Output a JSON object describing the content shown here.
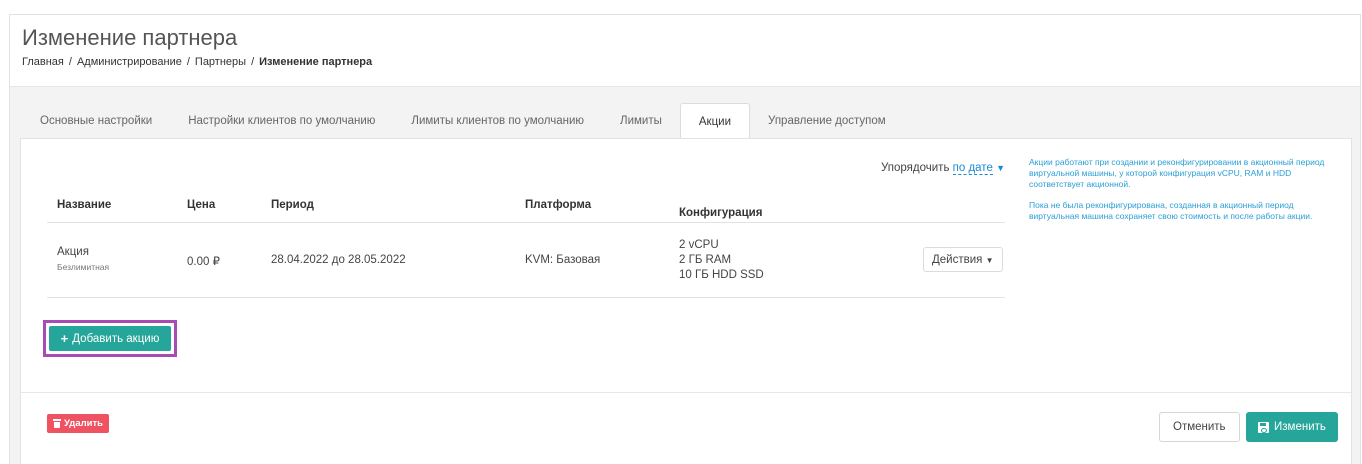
{
  "header": {
    "title": "Изменение партнера",
    "breadcrumbs": [
      "Главная",
      "Администрирование",
      "Партнеры",
      "Изменение партнера"
    ],
    "separator": "/"
  },
  "tabs": [
    {
      "label": "Основные настройки",
      "active": false
    },
    {
      "label": "Настройки клиентов по умолчанию",
      "active": false
    },
    {
      "label": "Лимиты клиентов по умолчанию",
      "active": false
    },
    {
      "label": "Лимиты",
      "active": false
    },
    {
      "label": "Акции",
      "active": true
    },
    {
      "label": "Управление доступом",
      "active": false
    }
  ],
  "sort": {
    "label": "Упорядочить",
    "value": "по дате",
    "icon": "caret-down-icon"
  },
  "info": {
    "paragraph1": "Акции работают при создании и реконфигурировании в акционный период виртуальной машины, у которой конфигурация vCPU, RAM и HDD соответствует акционной.",
    "paragraph2": "Пока не была реконфигурирована, созданная в акционный период виртуальная машина сохраняет свою стоимость и после работы акции."
  },
  "table": {
    "columns": [
      "Название",
      "Цена",
      "Период",
      "Платформа",
      "Конфигурация"
    ],
    "rows": [
      {
        "name": "Акция",
        "subtitle": "Безлимитная",
        "price": "0.00 ₽",
        "period": "28.04.2022 до 28.05.2022",
        "platform": "KVM: Базовая",
        "config": [
          "2 vCPU",
          "2 ГБ RAM",
          "10 ГБ HDD SSD"
        ],
        "actions_label": "Действия"
      }
    ]
  },
  "buttons": {
    "add": "Добавить акцию",
    "delete": "Удалить",
    "cancel": "Отменить",
    "save": "Изменить"
  },
  "colors": {
    "accent": "#26a69a",
    "danger": "#ef5362",
    "link": "#1b8ad3",
    "highlight": "#a94bb5"
  }
}
